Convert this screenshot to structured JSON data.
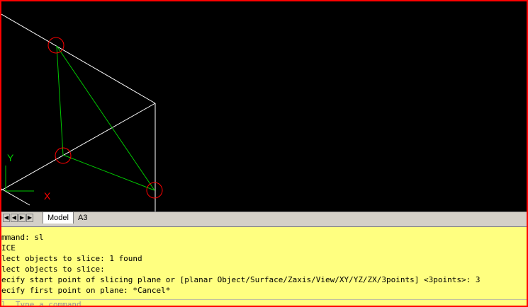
{
  "viewport": {
    "ucs_y_label": "Y",
    "ucs_x_label": "X",
    "colors": {
      "background": "#000000",
      "edges": "#ffffff",
      "triangle": "#00c800",
      "markers": "#ff0000",
      "ucs": "#00c800",
      "ucs_x": "#ff0000"
    }
  },
  "layout_tabs": {
    "nav_buttons": [
      "◀",
      "◀",
      "▶",
      "▶"
    ],
    "tabs": [
      {
        "label": "Model",
        "active": true
      },
      {
        "label": "A3",
        "active": false
      }
    ]
  },
  "command_window": {
    "background": "#ffff80",
    "lines": [
      "mmand: sl",
      "ICE",
      "lect objects to slice: 1 found",
      "lect objects to slice:",
      "ecify start point of slicing plane or [planar Object/Surface/Zaxis/View/XY/YZ/ZX/3points] <3points>: 3",
      "ecify first point on plane: *Cancel*"
    ],
    "input_placeholder": "l  Type a command"
  }
}
